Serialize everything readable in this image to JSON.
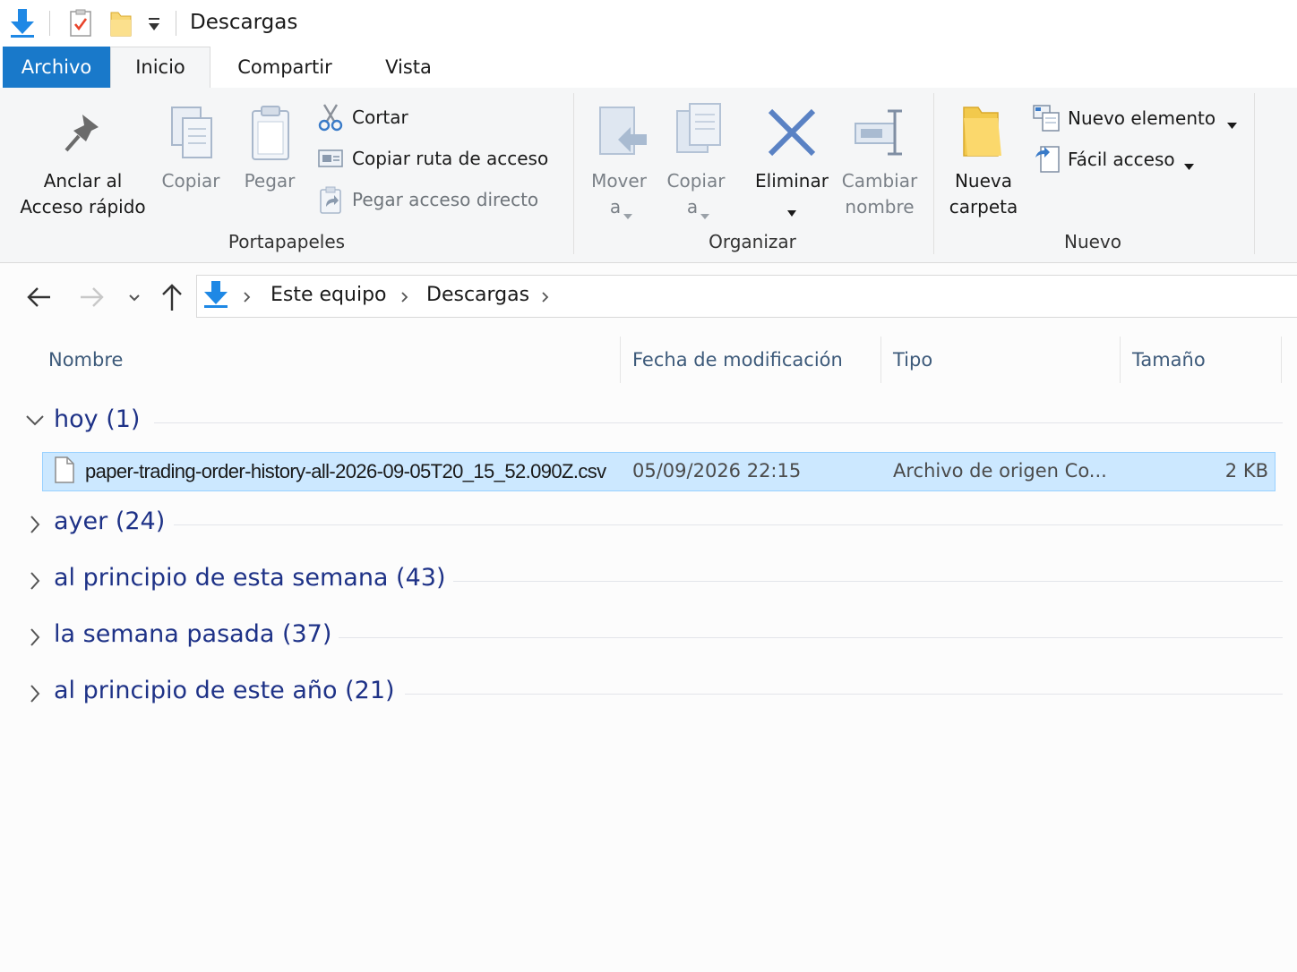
{
  "window": {
    "title": "Descargas"
  },
  "ribbon_tabs": [
    "Archivo",
    "Inicio",
    "Compartir",
    "Vista"
  ],
  "ribbon": {
    "portapapeles": {
      "label": "Portapapeles",
      "anclar_line1": "Anclar al",
      "anclar_line2": "Acceso rápido",
      "copiar": "Copiar",
      "pegar": "Pegar",
      "cortar": "Cortar",
      "copiar_ruta": "Copiar ruta de acceso",
      "pegar_acceso": "Pegar acceso directo"
    },
    "organizar": {
      "label": "Organizar",
      "mover_line1": "Mover",
      "mover_line2": "a",
      "copiar_line1": "Copiar",
      "copiar_line2": "a",
      "eliminar": "Eliminar",
      "cambiar_line1": "Cambiar",
      "cambiar_line2": "nombre"
    },
    "nuevo": {
      "label": "Nuevo",
      "nueva_line1": "Nueva",
      "nueva_line2": "carpeta",
      "nuevo_elemento": "Nuevo elemento",
      "facil_acceso": "Fácil acceso"
    }
  },
  "address": {
    "crumbs": [
      "Este equipo",
      "Descargas"
    ]
  },
  "columns": [
    "Nombre",
    "Fecha de modificación",
    "Tipo",
    "Tamaño"
  ],
  "groups": [
    {
      "title": "hoy (1)",
      "expanded": true
    },
    {
      "title": "ayer (24)",
      "expanded": false
    },
    {
      "title": "al principio de esta semana (43)",
      "expanded": false
    },
    {
      "title": "la semana pasada (37)",
      "expanded": false
    },
    {
      "title": "al principio de este año (21)",
      "expanded": false
    }
  ],
  "files": [
    {
      "name": "paper-trading-order-history-all-2026-09-05T20_15_52.090Z.csv",
      "modified": "05/09/2026 22:15",
      "type": "Archivo de origen Co...",
      "size": "2 KB",
      "selected": true
    }
  ],
  "colors": {
    "accent": "#1979ca",
    "selection": "#cce8ff",
    "group_text": "#1e3287"
  }
}
